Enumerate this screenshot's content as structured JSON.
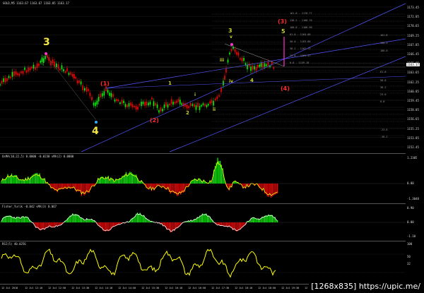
{
  "symbol_header": "GOLD,M5  1163.67 1163.67 1163.05 1163.17",
  "main": {
    "price_axis": [
      "1173.45",
      "1172.05",
      "1170.65",
      "1169.25",
      "1167.85",
      "1166.45",
      "1165.05",
      "1163.65",
      "1162.25",
      "1160.85",
      "1159.45",
      "1158.05",
      "1156.65",
      "1155.25",
      "1153.85",
      "1152.45"
    ],
    "current_price": "1163.17",
    "wave_labels": [
      {
        "text": "3",
        "color": "#f5e642"
      },
      {
        "text": "4",
        "color": "#f5e642"
      },
      {
        "text": "(1)",
        "color": "#ff2a2a"
      },
      {
        "text": "(2)",
        "color": "#ff2a2a"
      },
      {
        "text": "(3)",
        "color": "#ff2a2a"
      },
      {
        "text": "(4)",
        "color": "#ff2a2a"
      },
      {
        "text": "1",
        "color": "#cbd32f"
      },
      {
        "text": "2",
        "color": "#cbd32f"
      },
      {
        "text": "3",
        "color": "#cbd32f"
      },
      {
        "text": "4",
        "color": "#cbd32f"
      },
      {
        "text": "5",
        "color": "#cbd32f"
      },
      {
        "text": "i",
        "color": "#cbd32f"
      },
      {
        "text": "ii",
        "color": "#cbd32f"
      },
      {
        "text": "iii",
        "color": "#cbd32f"
      },
      {
        "text": "iv",
        "color": "#cbd32f"
      },
      {
        "text": "v",
        "color": "#cbd32f"
      }
    ],
    "fib_labels": [
      "161.8 - 1170.77",
      "138.2 - 1168.76",
      "100.0 - 1166.90",
      "61.8 - 1164.88",
      "50.0 - 1163.80",
      "38.2 - 1162.73",
      "23.6 - 1161.37",
      "0.0 - 1159.18",
      "161.8",
      "138.2",
      "100.0",
      "61.8",
      "50.0",
      "38.2",
      "23.6",
      "0.0",
      "-23.6",
      "-38.2"
    ]
  },
  "osma": {
    "label": "OsMA(10,22,5) 0.0000 -0.0230 vMA(2) 0.0000",
    "axis": [
      "1.2305",
      "0.00",
      "-1.3048"
    ]
  },
  "fisher": {
    "label": "Fisher_Yurik -0.042 vMA(3) 0.067",
    "axis": [
      "0.90",
      "0.00",
      "-1.10"
    ]
  },
  "rsi": {
    "label": "RSI(5) 40.0256",
    "axis": [
      "100",
      "50",
      "32"
    ]
  },
  "time_axis": [
    "12 Jul 2018",
    "12 Jul 12:10",
    "12 Jul 12:50",
    "12 Jul 13:30",
    "12 Jul 14:10",
    "12 Jul 14:50",
    "12 Jul 15:30",
    "12 Jul 16:10",
    "12 Jul 16:50",
    "12 Jul 17:30",
    "12 Jul 18:10",
    "12 Jul 18:50",
    "12 Jul 19:30",
    "12 Jul 20:10"
  ],
  "watermark": "[1268x835] https://upic.me/",
  "colors": {
    "bull": "#00ff00",
    "bear": "#ff0000",
    "line": "#ffff00",
    "channel": "#5555ff"
  }
}
